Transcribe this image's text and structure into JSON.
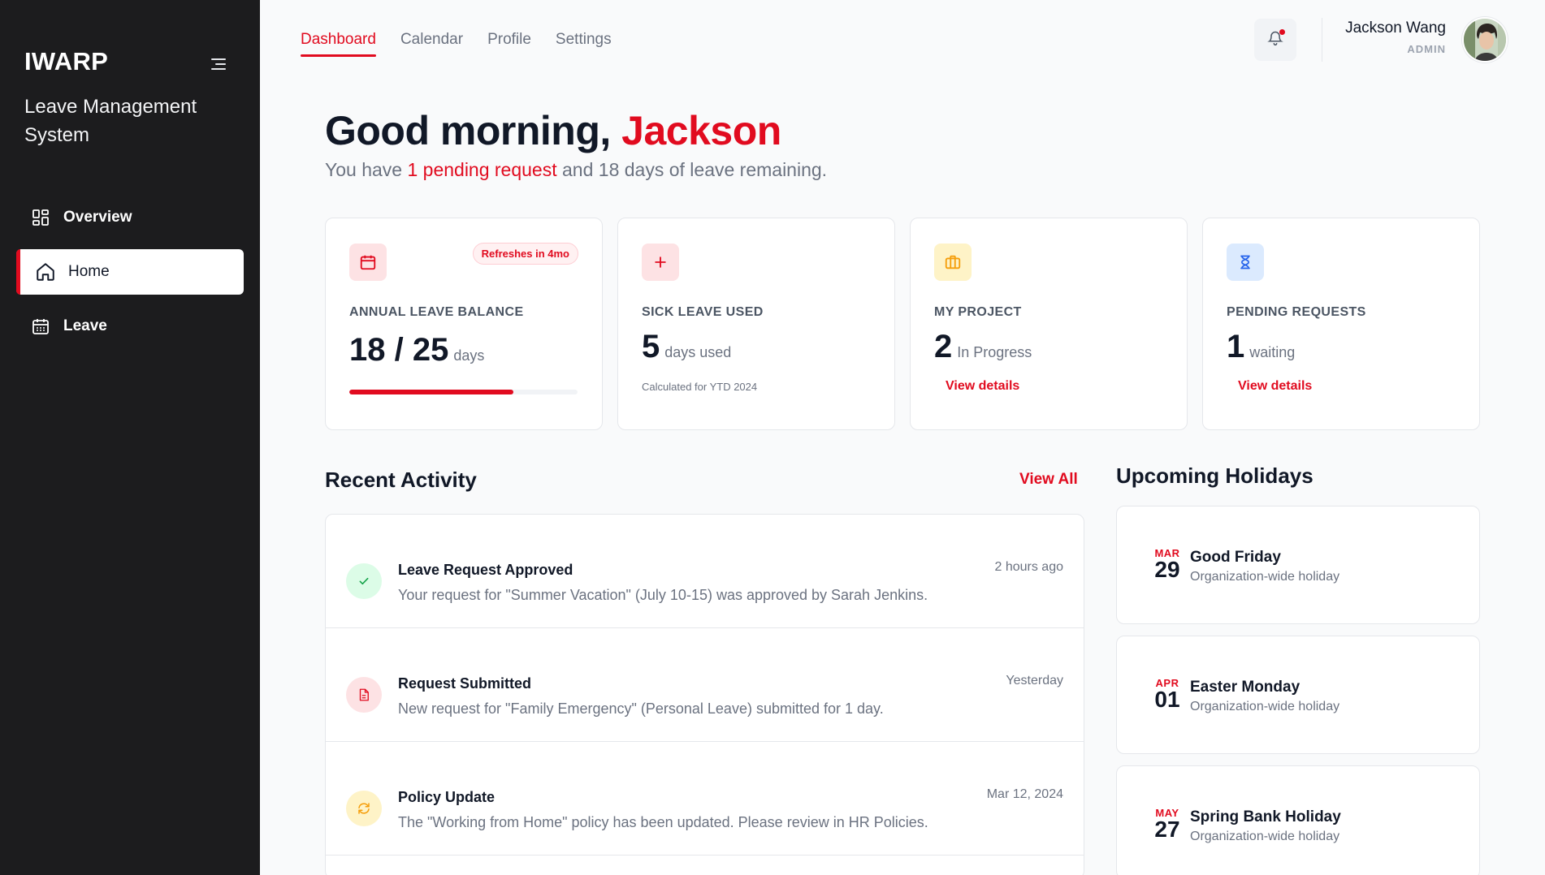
{
  "sidebar": {
    "brand": "IWARP",
    "subtitle": "Leave Management System",
    "items": [
      {
        "label": "Overview",
        "icon": "grid-icon"
      },
      {
        "label": "Home",
        "icon": "home-icon"
      },
      {
        "label": "Leave",
        "icon": "calendar-icon"
      }
    ]
  },
  "topnav": {
    "tabs": [
      {
        "label": "Dashboard"
      },
      {
        "label": "Calendar"
      },
      {
        "label": "Profile"
      },
      {
        "label": "Settings"
      }
    ]
  },
  "user": {
    "name": "Jackson Wang",
    "role": "ADMIN"
  },
  "greeting": {
    "prefix": "Good morning, ",
    "name": "Jackson",
    "sub_before": "You have ",
    "sub_highlight": "1 pending request",
    "sub_after": " and 18 days of leave remaining."
  },
  "cards": {
    "annual": {
      "label": "ANNUAL LEAVE BALANCE",
      "value": "18 / 25",
      "unit": "days",
      "badge": "Refreshes in 4mo",
      "progress_fraction": 0.72
    },
    "sick": {
      "label": "SICK LEAVE USED",
      "value": "5",
      "unit": "days used",
      "note": "Calculated for YTD 2024"
    },
    "project": {
      "label": "MY PROJECT",
      "value": "2",
      "unit": "In Progress",
      "link": "View details"
    },
    "pending": {
      "label": "PENDING REQUESTS",
      "value": "1",
      "unit": "waiting",
      "link": "View details"
    }
  },
  "activity": {
    "title": "Recent Activity",
    "view_all": "View All",
    "items": [
      {
        "title": "Leave Request Approved",
        "desc": "Your request for \"Summer Vacation\" (July 10-15) was approved by Sarah Jenkins.",
        "time": "2 hours ago",
        "icon": "check-icon"
      },
      {
        "title": "Request Submitted",
        "desc": "New request for \"Family Emergency\" (Personal Leave) submitted for 1 day.",
        "time": "Yesterday",
        "icon": "document-icon"
      },
      {
        "title": "Policy Update",
        "desc": "The \"Working from Home\" policy has been updated. Please review in HR Policies.",
        "time": "Mar 12, 2024",
        "icon": "refresh-icon"
      }
    ]
  },
  "holidays": {
    "title": "Upcoming Holidays",
    "items": [
      {
        "month": "MAR",
        "day": "29",
        "name": "Good Friday",
        "desc": "Organization-wide holiday"
      },
      {
        "month": "APR",
        "day": "01",
        "name": "Easter Monday",
        "desc": "Organization-wide holiday"
      },
      {
        "month": "MAY",
        "day": "27",
        "name": "Spring Bank Holiday",
        "desc": "Organization-wide holiday"
      }
    ]
  },
  "colors": {
    "accent": "#e10b1f",
    "sidebar_bg": "#1c1c1e",
    "success": "#16a34a",
    "warning": "#f59e0b",
    "info": "#2563eb"
  }
}
